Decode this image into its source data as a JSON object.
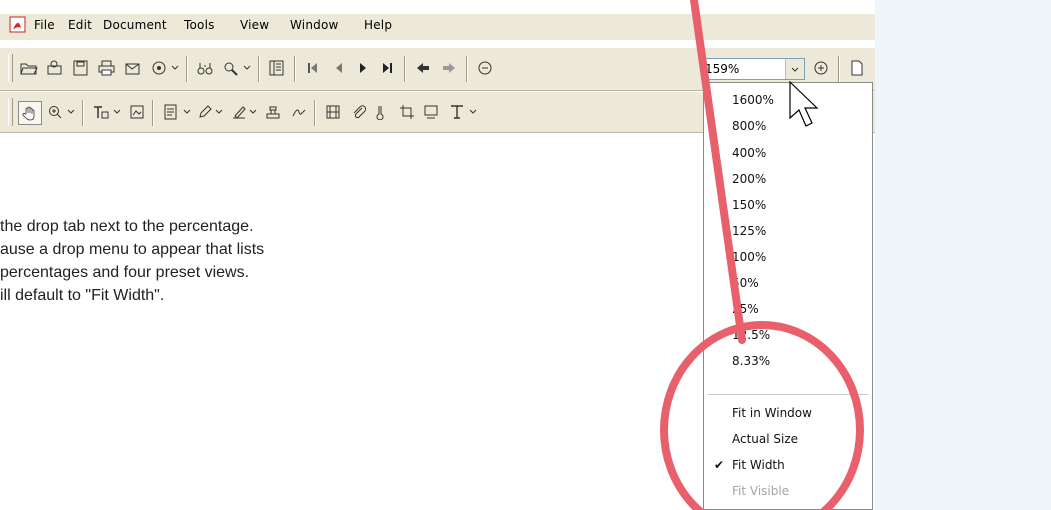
{
  "menubar": {
    "items": [
      "File",
      "Edit",
      "Document",
      "Tools",
      "View",
      "Window",
      "Help"
    ]
  },
  "zoom": {
    "value": "159%",
    "options": [
      "1600%",
      "800%",
      "400%",
      "200%",
      "150%",
      "125%",
      "100%",
      "50%",
      "25%",
      "12.5%",
      "8.33%"
    ],
    "views": [
      {
        "label": "Fit in Window",
        "checked": false,
        "enabled": true
      },
      {
        "label": "Actual Size",
        "checked": false,
        "enabled": true
      },
      {
        "label": "Fit Width",
        "checked": true,
        "enabled": true
      },
      {
        "label": "Fit Visible",
        "checked": false,
        "enabled": false
      }
    ]
  },
  "instructions": {
    "lines": [
      "the drop tab next to the percentage.",
      "ause a drop menu to appear that lists",
      "percentages and four preset views.",
      "ill default to \"Fit Width\"."
    ]
  },
  "colors": {
    "background": "#eef6fb",
    "toolbar": "#ece9d8",
    "highlight_ring": "#e8606c"
  }
}
